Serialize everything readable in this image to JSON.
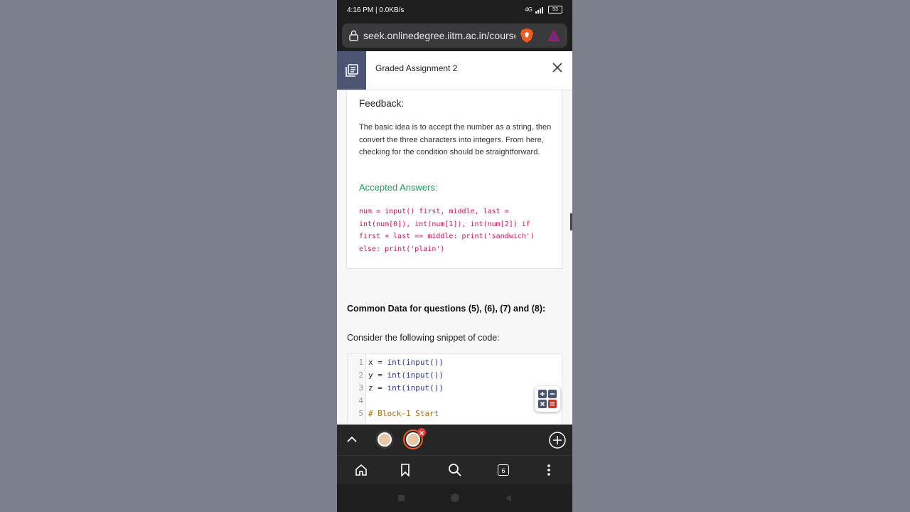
{
  "status_bar": {
    "time": "4:16 PM | 0.0KB/s",
    "network": "4G",
    "battery": "53"
  },
  "browser": {
    "url": "seek.onlinedegree.iitm.ac.in/courses",
    "tab_count": "6"
  },
  "header": {
    "title": "Graded Assignment 2"
  },
  "feedback": {
    "heading": "Feedback:",
    "text": "The basic idea is to accept the number as a string, then convert the three characters into integers. From here, checking for the condition should be straightforward.",
    "accepted_heading": "Accepted Answers:",
    "accepted_code": "num = input() first, middle, last = int(num[0]), int(num[1]), int(num[2]) if first + last == middle: print('sandwich') else: print('plain')"
  },
  "section": {
    "title": "Common Data for questions (5), (6), (7) and (8):",
    "consider": "Consider the following snippet of code:"
  },
  "code_lines": [
    {
      "n": "1",
      "var": "x = ",
      "fn": "int(input())",
      "comment": ""
    },
    {
      "n": "2",
      "var": "y = ",
      "fn": "int(input())",
      "comment": ""
    },
    {
      "n": "3",
      "var": "z = ",
      "fn": "int(input())",
      "comment": ""
    },
    {
      "n": "4",
      "var": "",
      "fn": "",
      "comment": ""
    },
    {
      "n": "5",
      "var": "",
      "fn": "",
      "comment": "# Block-1 Start"
    }
  ],
  "colors": {
    "accent_green": "#1f9d55",
    "code_pink": "#c2185b",
    "sidebar_icon_bg": "#4b5470"
  }
}
